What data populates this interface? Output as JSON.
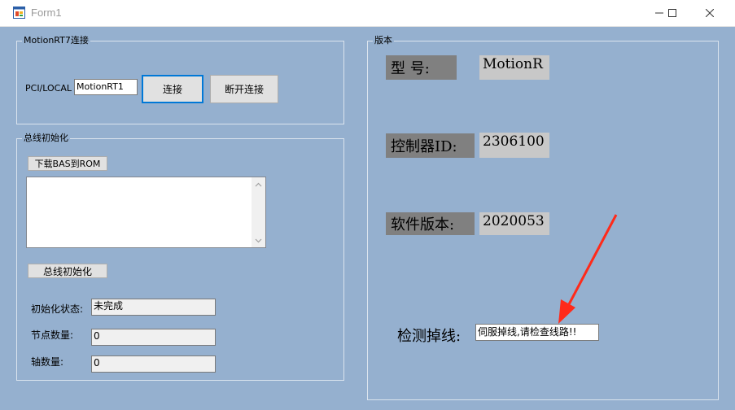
{
  "window": {
    "title": "Form1"
  },
  "connection_group": {
    "legend": "MotionRT7连接",
    "label": "PCI/LOCAL",
    "address_value": "MotionRT1",
    "connect_label": "连接",
    "disconnect_label": "断开连接"
  },
  "bus_group": {
    "legend": "总线初始化",
    "download_label": "下载BAS到ROM",
    "init_label": "总线初始化",
    "init_status_label": "初始化状态:",
    "init_status_value": "未完成",
    "node_count_label": "节点数量:",
    "node_count_value": "0",
    "axis_count_label": "轴数量:",
    "axis_count_value": "0"
  },
  "version_group": {
    "legend": "版本",
    "model_label": "型  号:",
    "model_value": "MotionR",
    "controller_id_label": "控制器ID:",
    "controller_id_value": "2306100",
    "software_version_label": "软件版本:",
    "software_version_value": "2020053",
    "disconnect_detect_label": "检测掉线:",
    "disconnect_detect_value": "伺服掉线,请检查线路!!"
  },
  "annotation": {
    "arrow_color": "#ff2a1a"
  }
}
